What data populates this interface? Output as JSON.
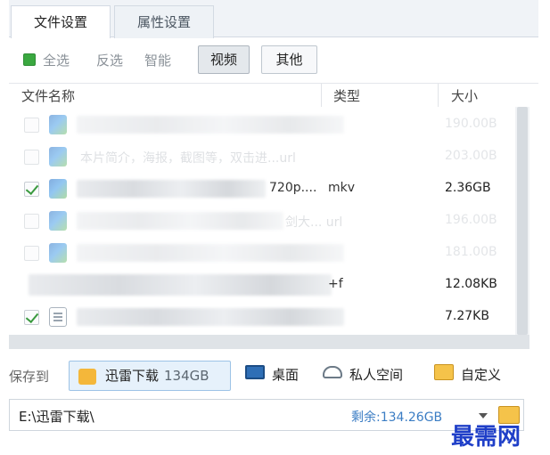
{
  "tabs": [
    {
      "label": "文件设置",
      "active": true
    },
    {
      "label": "属性设置",
      "active": false
    }
  ],
  "filter": {
    "select_all": "全选",
    "invert": "反选",
    "smart": "智能",
    "video": "视频",
    "other": "其他"
  },
  "table": {
    "headers": {
      "name": "文件名称",
      "type": "类型",
      "size": "大小"
    },
    "rows": [
      {
        "checked": false,
        "icon": "image-file-icon",
        "name": "",
        "type": "",
        "size": "190.00B",
        "dim": true
      },
      {
        "checked": false,
        "icon": "url-file-icon",
        "name": "本片简介，海报，截图等，双击进...url",
        "type": "",
        "size": "203.00B",
        "dim": true
      },
      {
        "checked": true,
        "icon": "video-file-icon",
        "name": "720p....",
        "type": "mkv",
        "size": "2.36GB",
        "dim": false
      },
      {
        "checked": false,
        "icon": "image-file-icon",
        "name": "剑大... url",
        "type": "",
        "size": "196.00B",
        "dim": true
      },
      {
        "checked": false,
        "icon": "image-file-icon",
        "name": "",
        "type": "",
        "size": "181.00B",
        "dim": true
      },
      {
        "checked": false,
        "icon": "blank-file-icon",
        "name": "",
        "type": "+f",
        "size": "12.08KB",
        "dim": false
      },
      {
        "checked": true,
        "icon": "text-file-icon",
        "name": "",
        "type": "",
        "size": "7.27KB",
        "dim": false
      }
    ]
  },
  "save": {
    "label": "保存到",
    "thunder": "迅雷下载",
    "thunder_free": "134GB",
    "desktop": "桌面",
    "private": "私人空间",
    "custom": "自定义"
  },
  "path": {
    "value": "E:\\迅雷下载\\",
    "free": "剩余:134.26GB"
  },
  "watermark": "最需网",
  "colors": {
    "accent": "#3b7dc4",
    "check": "#3a9a3f",
    "watermark": "#1f3fc8"
  }
}
